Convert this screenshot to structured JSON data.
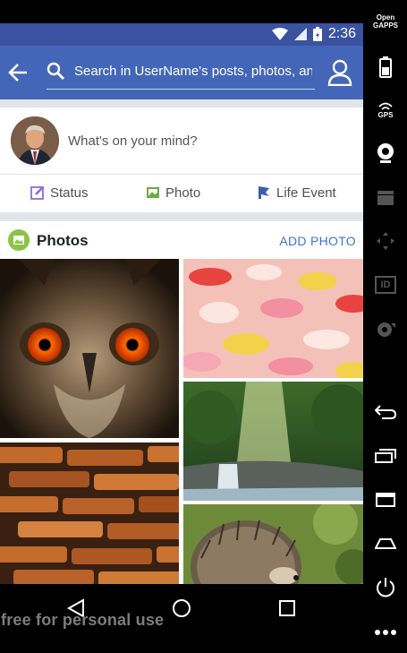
{
  "status_bar": {
    "time": "2:36"
  },
  "app_bar": {
    "search_text": "Search in UserName's posts, photos, and"
  },
  "composer": {
    "prompt": "What's on your mind?",
    "actions": [
      {
        "label": "Status",
        "icon": "edit-icon"
      },
      {
        "label": "Photo",
        "icon": "photo-icon"
      },
      {
        "label": "Life Event",
        "icon": "flag-icon"
      }
    ]
  },
  "photos": {
    "title": "Photos",
    "add_label": "ADD PHOTO",
    "items": [
      {
        "subject": "owl",
        "icon": "owl-photo"
      },
      {
        "subject": "rose petals",
        "icon": "petals-photo"
      },
      {
        "subject": "forest waterfall",
        "icon": "waterfall-photo"
      },
      {
        "subject": "brick wall",
        "icon": "bricks-photo"
      },
      {
        "subject": "hedgehog",
        "icon": "hedgehog-photo"
      }
    ]
  },
  "watermark": "free for personal use",
  "side_panel": {
    "gapps_label_1": "Open",
    "gapps_label_2": "GAPPS",
    "gps_label": "GPS",
    "id_label": "ID"
  },
  "colors": {
    "app_bar": "#4466b8",
    "status_bar": "#3a52a0",
    "link": "#3b73d3",
    "photos_icon": "#8bc34a"
  }
}
